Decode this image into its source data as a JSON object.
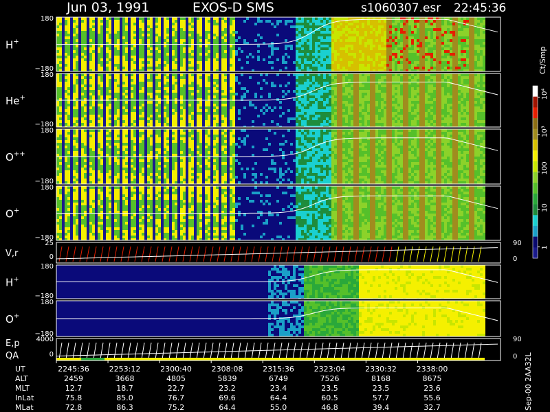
{
  "header": {
    "date": "Jun 03, 1991",
    "instrument": "EXOS-D SMS",
    "file": "s1060307.esr",
    "time": "22:45:36"
  },
  "footer_code": "Sep-00  2AA32L",
  "colorbar": {
    "unit_label": "Ct/Smp",
    "scale": "log",
    "range": [
      0.5,
      20000
    ],
    "tick_labels": [
      "1",
      "10",
      "100",
      "10³",
      "10⁴"
    ],
    "colors": [
      "#1a1a8c",
      "#0a0a6e",
      "#1aa0c8",
      "#1ad0d0",
      "#1e8c3c",
      "#2aa83a",
      "#55c02a",
      "#8cd22a",
      "#c8e600",
      "#f5f000",
      "#d6c000",
      "#a08c1e",
      "#8c6e14",
      "#e61e00",
      "#a01400",
      "#ffffff"
    ]
  },
  "chart_data": [
    {
      "type": "heatmap",
      "panel": "H+",
      "label": "H",
      "sup": "+",
      "y_tick_labels": [
        "180",
        "−180"
      ],
      "ylim": [
        -180,
        180
      ],
      "plateau": 1.15
    },
    {
      "type": "heatmap",
      "panel": "He+",
      "label": "He",
      "sup": "+",
      "y_tick_labels": [
        "180",
        "−180"
      ],
      "ylim": [
        -180,
        180
      ],
      "plateau": 0.85
    },
    {
      "type": "heatmap",
      "panel": "O++",
      "label": "O",
      "sup": "++",
      "y_tick_labels": [
        "180",
        "−180"
      ],
      "ylim": [
        -180,
        180
      ],
      "plateau": 0.85
    },
    {
      "type": "heatmap",
      "panel": "O+",
      "label": "O",
      "sup": "+",
      "y_tick_labels": [
        "180",
        "−180"
      ],
      "ylim": [
        -180,
        180
      ],
      "plateau": 0.8
    },
    {
      "type": "line",
      "panel": "V,r",
      "label": "V,r",
      "left_ticks": [
        "25",
        "0"
      ],
      "right_ticks": [
        "90",
        "0"
      ]
    },
    {
      "type": "heatmap",
      "panel": "H+ (2)",
      "label": "H",
      "sup": "+",
      "y_tick_labels": [
        "180",
        "−180"
      ],
      "ylim": [
        -180,
        180
      ],
      "plateau": 0.9
    },
    {
      "type": "heatmap",
      "panel": "O+ (2)",
      "label": "O",
      "sup": "+",
      "y_tick_labels": [
        "180",
        "−180"
      ],
      "ylim": [
        -180,
        180
      ],
      "plateau": 0.75
    },
    {
      "type": "line",
      "panel": "E,p QA",
      "label": "E,p",
      "label2": "QA",
      "left_ticks": [
        "4000",
        "0"
      ],
      "right_ticks": [
        "90",
        "0"
      ]
    }
  ],
  "table": {
    "row_labels": [
      "UT",
      "ALT",
      "MLT",
      "InLat",
      "MLat"
    ],
    "columns": [
      [
        "2245:36",
        "2459",
        "12.7",
        "75.8",
        "72.8"
      ],
      [
        "2253:12",
        "3668",
        "18.7",
        "85.0",
        "86.3"
      ],
      [
        "2300:40",
        "4805",
        "22.7",
        "76.7",
        "75.2"
      ],
      [
        "2308:08",
        "5839",
        "23.2",
        "69.6",
        "64.4"
      ],
      [
        "2315:36",
        "6749",
        "23.4",
        "64.4",
        "55.0"
      ],
      [
        "2323:04",
        "7526",
        "23.5",
        "60.5",
        "46.8"
      ],
      [
        "2330:32",
        "8168",
        "23.5",
        "57.7",
        "39.4"
      ],
      [
        "2338:00",
        "8675",
        "23.6",
        "55.6",
        "32.7"
      ]
    ]
  }
}
